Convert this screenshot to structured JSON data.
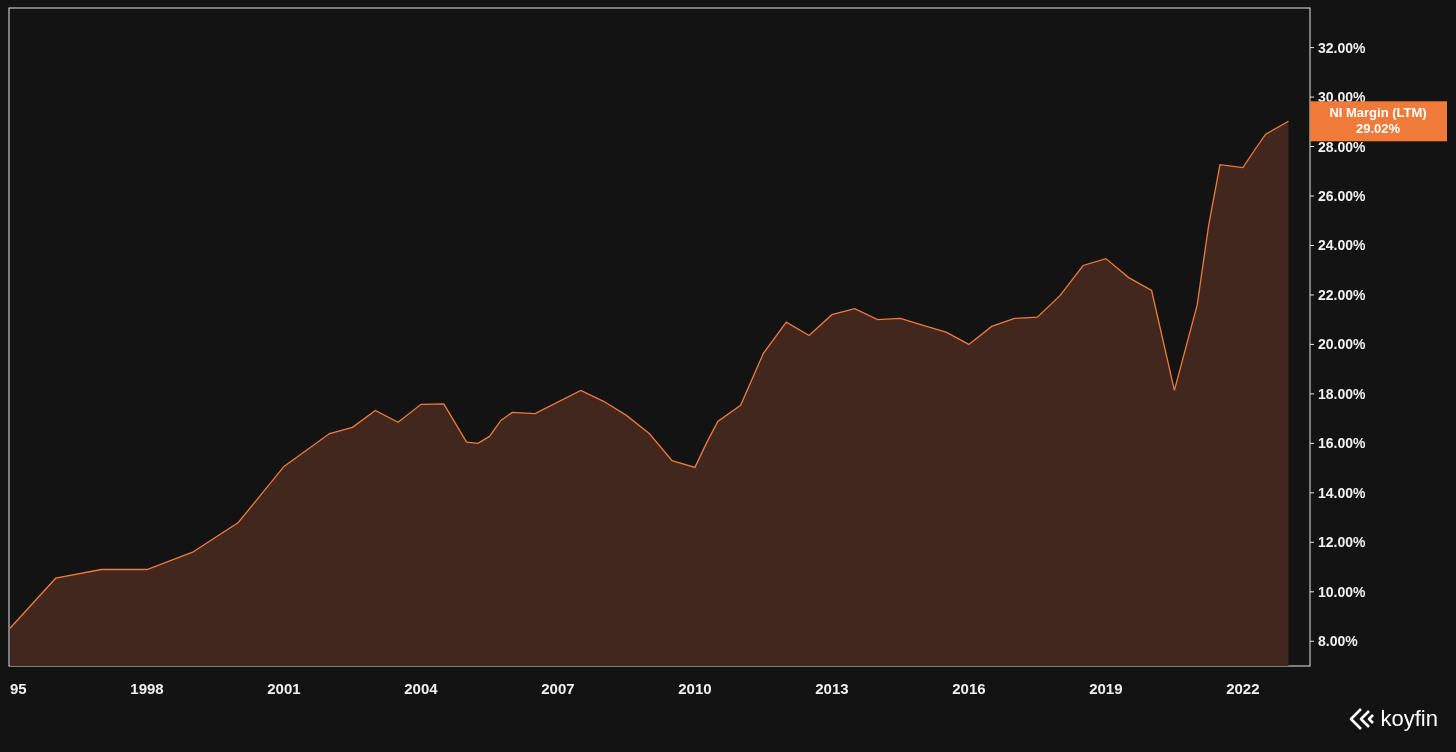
{
  "chart": {
    "chart_data": {
      "type": "area",
      "x": [
        1995,
        1996,
        1997,
        1998,
        1999,
        2000,
        2001,
        2002,
        2002.5,
        2003,
        2003.5,
        2004,
        2004.5,
        2005,
        2005.25,
        2005.5,
        2005.75,
        2006,
        2006.5,
        2007.5,
        2008,
        2008.5,
        2009,
        2009.5,
        2010,
        2010.25,
        2010.5,
        2011,
        2011.5,
        2012,
        2012.5,
        2013,
        2013.5,
        2014,
        2014.5,
        2015,
        2015.5,
        2016,
        2016.5,
        2017,
        2017.5,
        2018,
        2018.5,
        2019,
        2019.5,
        2020,
        2020.5,
        2021,
        2021.25,
        2021.5,
        2022,
        2022.25,
        2022.5,
        2023
      ],
      "series": [
        {
          "name": "NI Margin (LTM)",
          "color": "#f07a3a",
          "values": [
            8.53,
            10.55,
            10.9,
            10.9,
            11.6,
            12.8,
            15.07,
            16.4,
            16.65,
            17.33,
            16.85,
            17.58,
            17.6,
            16.05,
            16.0,
            16.28,
            16.93,
            17.25,
            17.2,
            18.14,
            17.7,
            17.13,
            16.4,
            15.3,
            15.03,
            16.0,
            16.89,
            17.54,
            19.64,
            20.9,
            20.36,
            21.2,
            21.45,
            21.0,
            21.05,
            20.77,
            20.5,
            20.0,
            20.73,
            21.05,
            21.1,
            21.98,
            23.19,
            23.47,
            22.7,
            22.18,
            18.14,
            21.6,
            24.8,
            27.27,
            27.15,
            27.84,
            28.5,
            29.02
          ]
        }
      ],
      "xlim": [
        1995,
        2023.47
      ],
      "ylim": [
        7,
        33.6
      ],
      "xticks": [
        {
          "value": 1995,
          "label": "95"
        },
        {
          "value": 1998,
          "label": "1998"
        },
        {
          "value": 2001,
          "label": "2001"
        },
        {
          "value": 2004,
          "label": "2004"
        },
        {
          "value": 2007,
          "label": "2007"
        },
        {
          "value": 2010,
          "label": "2010"
        },
        {
          "value": 2013,
          "label": "2013"
        },
        {
          "value": 2016,
          "label": "2016"
        },
        {
          "value": 2019,
          "label": "2019"
        },
        {
          "value": 2022,
          "label": "2022"
        }
      ],
      "yticks": [
        {
          "value": 8,
          "label": "8.00%"
        },
        {
          "value": 10,
          "label": "10.00%"
        },
        {
          "value": 12,
          "label": "12.00%"
        },
        {
          "value": 14,
          "label": "14.00%"
        },
        {
          "value": 16,
          "label": "16.00%"
        },
        {
          "value": 18,
          "label": "18.00%"
        },
        {
          "value": 20,
          "label": "20.00%"
        },
        {
          "value": 22,
          "label": "22.00%"
        },
        {
          "value": 24,
          "label": "24.00%"
        },
        {
          "value": 26,
          "label": "26.00%"
        },
        {
          "value": 28,
          "label": "28.00%"
        },
        {
          "value": 30,
          "label": "30.00%"
        },
        {
          "value": 32,
          "label": "32.00%"
        }
      ],
      "annotations": [
        "29.02%"
      ]
    }
  },
  "logo": {
    "text": "koyfin"
  }
}
